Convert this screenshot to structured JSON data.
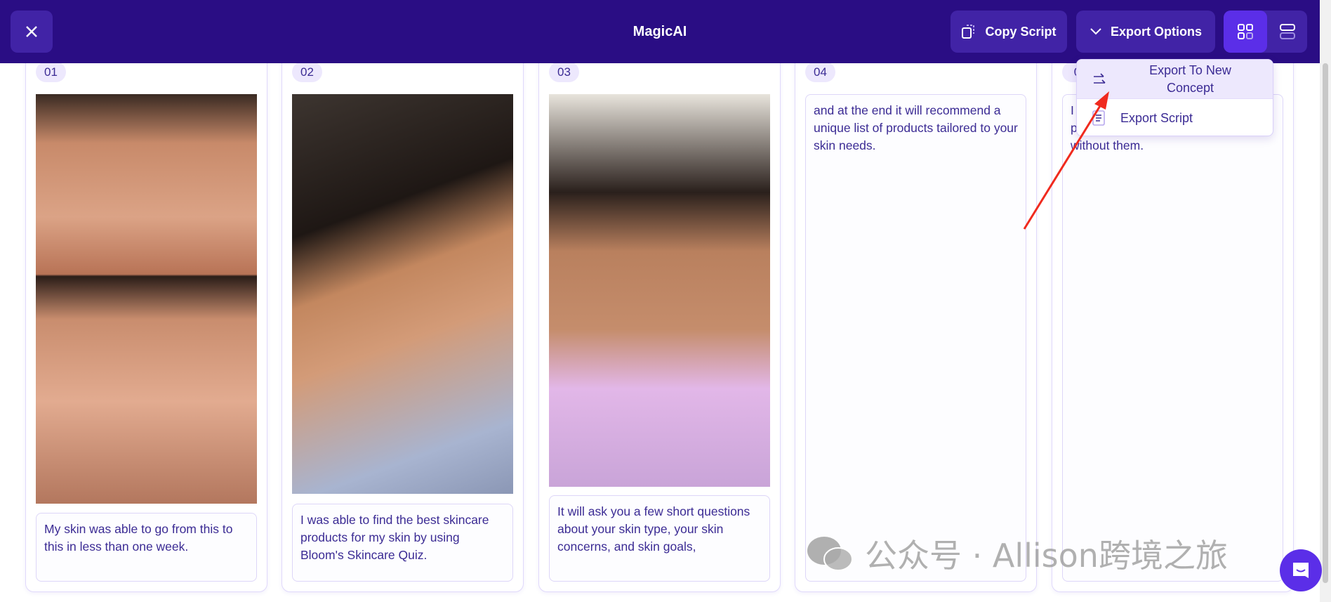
{
  "header": {
    "title": "MagicAI",
    "close_icon": "close-icon",
    "copy_script": "Copy Script",
    "export_options": "Export Options",
    "view_grid": "grid-view-icon",
    "view_list": "list-view-icon"
  },
  "dropdown": {
    "items": [
      {
        "label": "Export To New Concept",
        "icon": "arrow-right-icon"
      },
      {
        "label": "Export Script",
        "icon": "document-icon"
      }
    ]
  },
  "cards": [
    {
      "num": "01",
      "text": "My skin was able to go from this to this in less than one week."
    },
    {
      "num": "02",
      "text": "I was able to find the best skincare products for my skin by using Bloom's Skincare Quiz."
    },
    {
      "num": "03",
      "text": "It will ask you a few short questions about your skin type, your skin concerns, and skin goals,"
    },
    {
      "num": "04",
      "text": "and at the end it will recommend a unique list of products tailored to your skin needs."
    },
    {
      "num": "0",
      "text_lines": [
        "I",
        "p",
        "without them."
      ]
    }
  ],
  "watermark": "公众号 · Allison跨境之旅",
  "colors": {
    "header": "#2a0d84",
    "button": "#4123a6",
    "accent": "#5b2ee8",
    "text": "#3b2b94"
  }
}
